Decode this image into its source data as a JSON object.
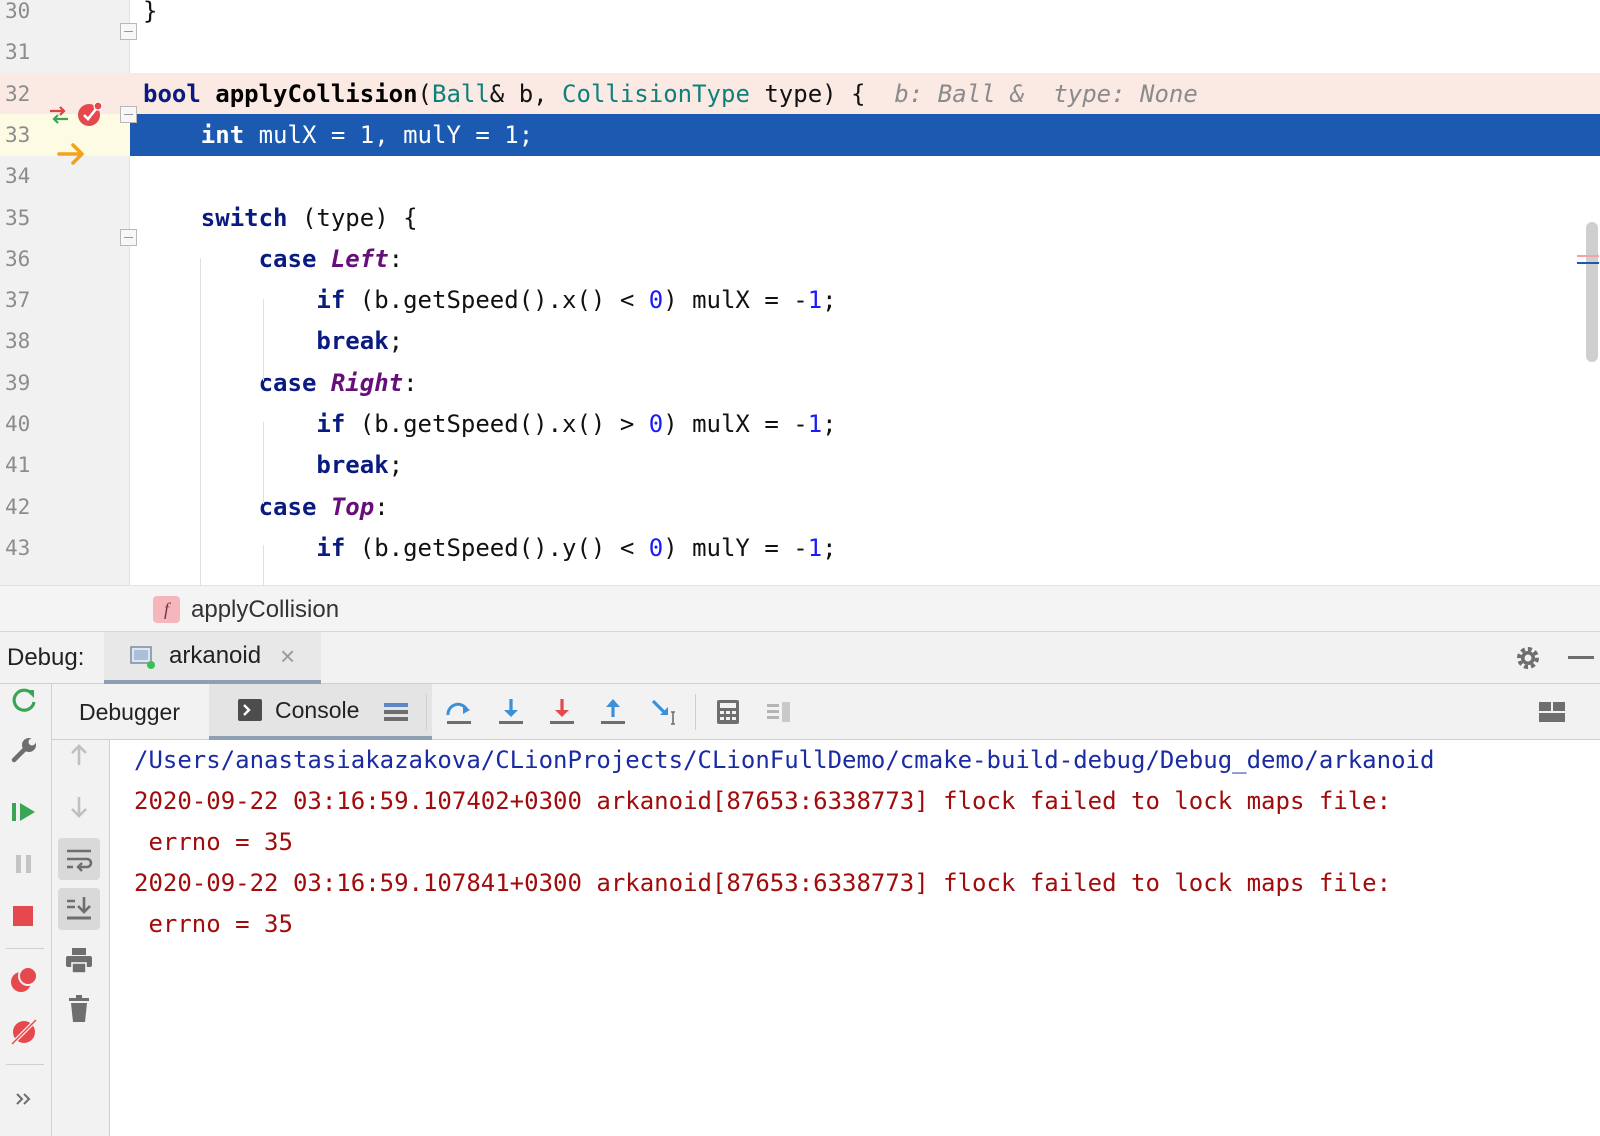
{
  "editor": {
    "lines": [
      {
        "n": "30",
        "t": [
          [
            "}",
            ""
          ]
        ]
      },
      {
        "n": "31",
        "t": []
      },
      {
        "n": "32",
        "t": [
          [
            "bool ",
            "kw"
          ],
          [
            "applyCollision",
            "fn"
          ],
          [
            "(",
            ""
          ],
          [
            "Ball",
            "ty"
          ],
          [
            "& b, ",
            ""
          ],
          [
            "CollisionType",
            "ty"
          ],
          [
            " type) {  ",
            ""
          ],
          [
            "b: Ball &  type: None",
            "hint"
          ]
        ]
      },
      {
        "n": "33",
        "t": [
          [
            "    ",
            ""
          ],
          [
            "int",
            "kw"
          ],
          [
            " mulX = 1, mulY = 1;",
            ""
          ]
        ]
      },
      {
        "n": "34",
        "t": []
      },
      {
        "n": "35",
        "t": [
          [
            "    ",
            ""
          ],
          [
            "switch",
            "kw"
          ],
          [
            " (type) {",
            ""
          ]
        ]
      },
      {
        "n": "36",
        "t": [
          [
            "        ",
            ""
          ],
          [
            "case ",
            "kw"
          ],
          [
            "Left",
            "en"
          ],
          [
            ":",
            ""
          ]
        ]
      },
      {
        "n": "37",
        "t": [
          [
            "            ",
            ""
          ],
          [
            "if",
            "kw"
          ],
          [
            " (b.getSpeed().x() < ",
            ""
          ],
          [
            "0",
            "nm"
          ],
          [
            ") mulX = -",
            ""
          ],
          [
            "1",
            "nm"
          ],
          [
            ";",
            ""
          ]
        ]
      },
      {
        "n": "38",
        "t": [
          [
            "            ",
            ""
          ],
          [
            "break",
            "kw"
          ],
          [
            ";",
            ""
          ]
        ]
      },
      {
        "n": "39",
        "t": [
          [
            "        ",
            ""
          ],
          [
            "case ",
            "kw"
          ],
          [
            "Right",
            "en"
          ],
          [
            ":",
            ""
          ]
        ]
      },
      {
        "n": "40",
        "t": [
          [
            "            ",
            ""
          ],
          [
            "if",
            "kw"
          ],
          [
            " (b.getSpeed().x() > ",
            ""
          ],
          [
            "0",
            "nm"
          ],
          [
            ") mulX = -",
            ""
          ],
          [
            "1",
            "nm"
          ],
          [
            ";",
            ""
          ]
        ]
      },
      {
        "n": "41",
        "t": [
          [
            "            ",
            ""
          ],
          [
            "break",
            "kw"
          ],
          [
            ";",
            ""
          ]
        ]
      },
      {
        "n": "42",
        "t": [
          [
            "        ",
            ""
          ],
          [
            "case ",
            "kw"
          ],
          [
            "Top",
            "en"
          ],
          [
            ":",
            ""
          ]
        ]
      },
      {
        "n": "43",
        "t": [
          [
            "            ",
            ""
          ],
          [
            "if",
            "kw"
          ],
          [
            " (b.getSpeed().y() < ",
            ""
          ],
          [
            "0",
            "nm"
          ],
          [
            ") mulY = -",
            ""
          ],
          [
            "1",
            "nm"
          ],
          [
            ";",
            ""
          ]
        ]
      }
    ],
    "breakpoint_line": "32",
    "execution_line": "33"
  },
  "breadcrumb": {
    "badge": "f",
    "function": "applyCollision"
  },
  "debug": {
    "label": "Debug:",
    "session": "arkanoid",
    "close_glyph": "×"
  },
  "tabs": {
    "debugger": "Debugger",
    "console": "Console"
  },
  "console": {
    "lines": [
      {
        "text": "/Users/anastasiakazakova/CLionProjects/CLionFullDemo/cmake-build-debug/Debug_demo/arkanoid",
        "kind": "path"
      },
      {
        "text": "2020-09-22 03:16:59.107402+0300 arkanoid[87653:6338773] flock failed to lock maps file:",
        "kind": "err"
      },
      {
        "text": " errno = 35",
        "kind": "err"
      },
      {
        "text": "2020-09-22 03:16:59.107841+0300 arkanoid[87653:6338773] flock failed to lock maps file:",
        "kind": "err"
      },
      {
        "text": " errno = 35",
        "kind": "err"
      }
    ]
  },
  "colors": {
    "execution_highlight": "#1b5ab0",
    "breakpoint_line": "#fbe9e4",
    "keyword": "#0a1b80",
    "type": "#10807a",
    "enum": "#660e7a",
    "number": "#1a1aff",
    "console_path": "#1a2ba3",
    "console_error": "#a00c0c"
  },
  "icons": {
    "left_toolbar": [
      "rerun-icon",
      "wrench-icon",
      "resume-icon",
      "pause-icon",
      "stop-icon",
      "view-breakpoints-icon",
      "mute-breakpoints-icon",
      "more-icon"
    ],
    "top_toolbar": [
      "layout-icon",
      "step-over-icon",
      "step-into-icon",
      "force-step-into-icon",
      "step-out-icon",
      "run-to-cursor-icon",
      "evaluate-expression-icon",
      "trace-icon",
      "restore-layout-icon"
    ],
    "console_toolbar": [
      "up-arrow-icon",
      "down-arrow-icon",
      "soft-wrap-icon",
      "scroll-to-end-icon",
      "print-icon",
      "clear-icon"
    ]
  }
}
